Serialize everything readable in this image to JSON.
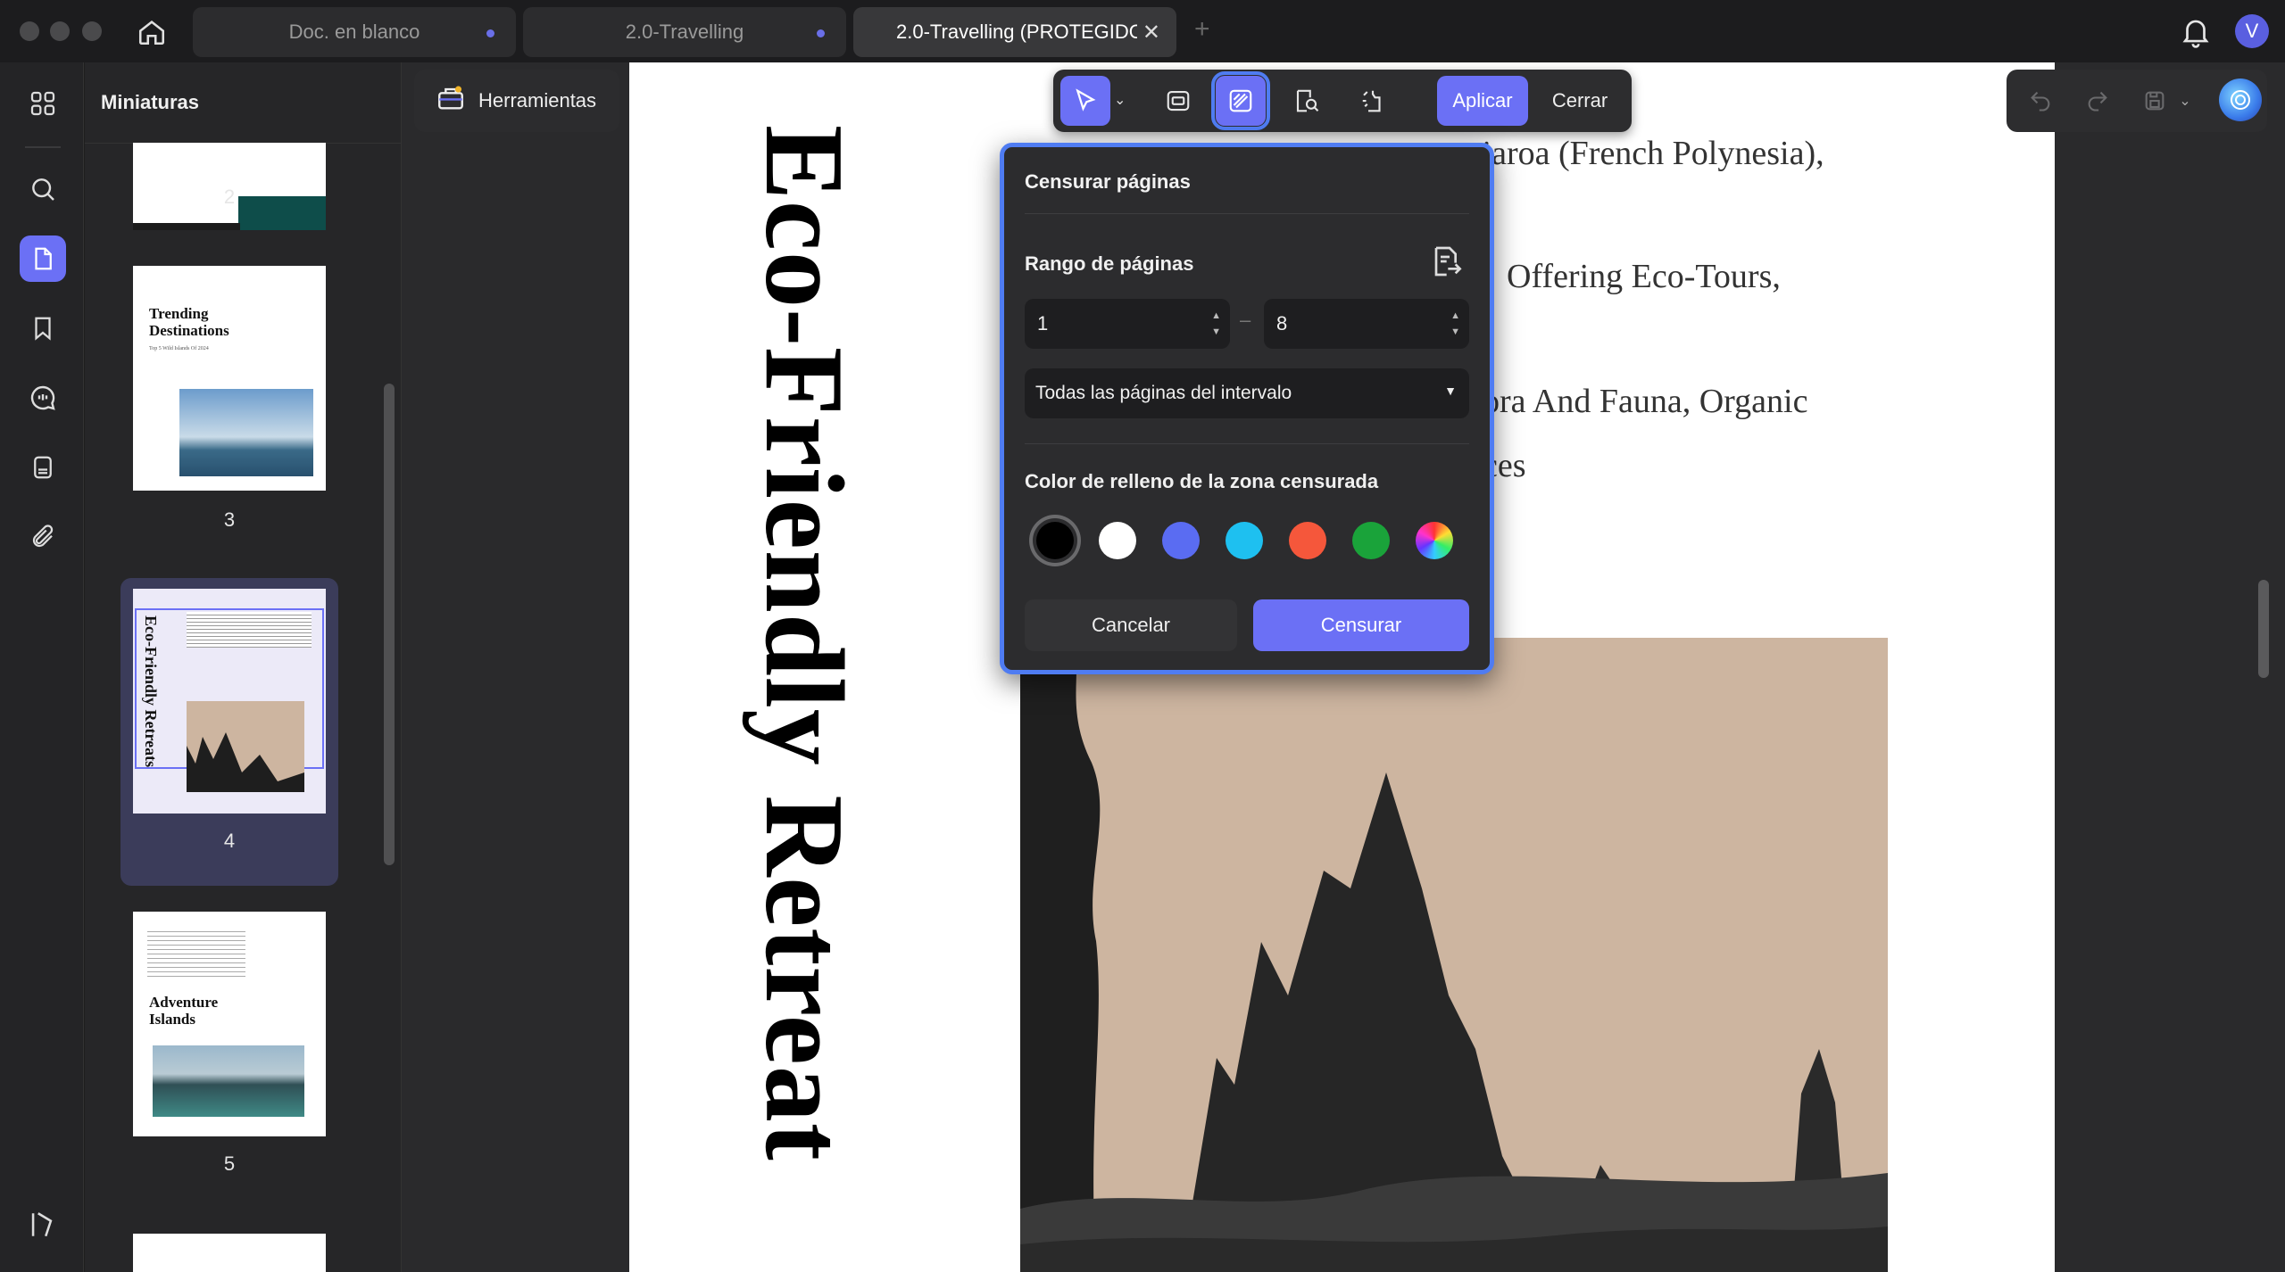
{
  "tabs": [
    {
      "label": "Doc. en blanco",
      "state": "unsaved-dot"
    },
    {
      "label": "2.0-Travelling",
      "state": "unsaved-dot"
    },
    {
      "label": "2.0-Travelling (PROTEGIDO",
      "state": "active-close"
    }
  ],
  "user": {
    "avatar_letter": "V"
  },
  "sidebar": {
    "icons": [
      "thumbnails-icon",
      "search-icon",
      "pages-icon",
      "bookmark-icon",
      "comment-icon",
      "document-icon",
      "attachment-icon"
    ],
    "active": "pages-icon"
  },
  "thumbnails": {
    "title": "Miniaturas",
    "pages": [
      {
        "number": "2"
      },
      {
        "number": "3",
        "heading": "Trending Destinations",
        "sub": "Top 5 Wild Islands Of 2024"
      },
      {
        "number": "4",
        "vertical_title": "Eco-Friendly Retreats",
        "selected": true
      },
      {
        "number": "5",
        "heading": "Adventure Islands"
      }
    ]
  },
  "tools": {
    "label": "Herramientas"
  },
  "redact_toolbar": {
    "apply_label": "Aplicar",
    "close_label": "Cerrar",
    "icons": [
      "select-icon",
      "redact-area-icon",
      "redact-pages-icon",
      "search-redact-icon",
      "redact-text-icon"
    ]
  },
  "document": {
    "vertical_title": "Eco-Friendly Retreat",
    "lines": [
      "tiaroa (French Polynesia),",
      "Offering Eco-Tours,",
      "ora And Fauna, Organic",
      "ces"
    ]
  },
  "popup": {
    "title": "Censurar páginas",
    "range_label": "Rango de páginas",
    "range_from": "1",
    "range_to": "8",
    "range_mode": "Todas las páginas del intervalo",
    "color_label": "Color de relleno de la zona censurada",
    "colors": [
      "#000000",
      "#ffffff",
      "#5a6cf2",
      "#1ec0f0",
      "#f5573b",
      "#1aa33a",
      "rainbow"
    ],
    "selected_color": "#000000",
    "cancel_label": "Cancelar",
    "redact_label": "Censurar"
  }
}
